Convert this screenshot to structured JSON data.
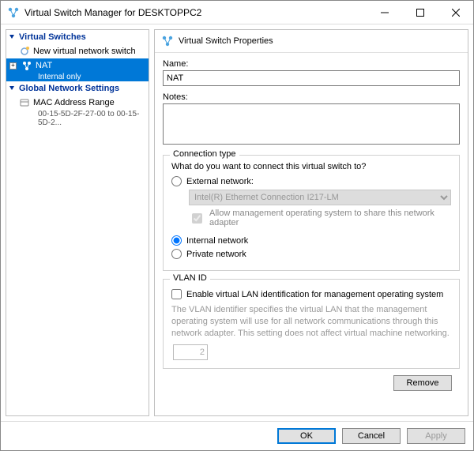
{
  "window": {
    "title": "Virtual Switch Manager for DESKTOPPC2"
  },
  "sidebar": {
    "sections": {
      "virtual_switches": {
        "header": "Virtual Switches",
        "items": [
          {
            "label": "New virtual network switch"
          },
          {
            "label": "NAT",
            "sub": "Internal only",
            "selected": true
          }
        ]
      },
      "global_settings": {
        "header": "Global Network Settings",
        "items": [
          {
            "label": "MAC Address Range",
            "sub": "00-15-5D-2F-27-00 to 00-15-5D-2..."
          }
        ]
      }
    }
  },
  "main": {
    "header": "Virtual Switch Properties",
    "name_label": "Name:",
    "name_value": "NAT",
    "notes_label": "Notes:",
    "notes_value": "",
    "connection": {
      "legend": "Connection type",
      "prompt": "What do you want to connect this virtual switch to?",
      "external_label": "External network:",
      "external_adapter": "Intel(R) Ethernet Connection I217-LM",
      "allow_mgmt": "Allow management operating system to share this network adapter",
      "internal_label": "Internal network",
      "private_label": "Private network"
    },
    "vlan": {
      "legend": "VLAN ID",
      "enable_label": "Enable virtual LAN identification for management operating system",
      "help": "The VLAN identifier specifies the virtual LAN that the management operating system will use for all network communications through this network adapter. This setting does not affect virtual machine networking.",
      "value": "2"
    },
    "remove_label": "Remove"
  },
  "footer": {
    "ok": "OK",
    "cancel": "Cancel",
    "apply": "Apply"
  }
}
